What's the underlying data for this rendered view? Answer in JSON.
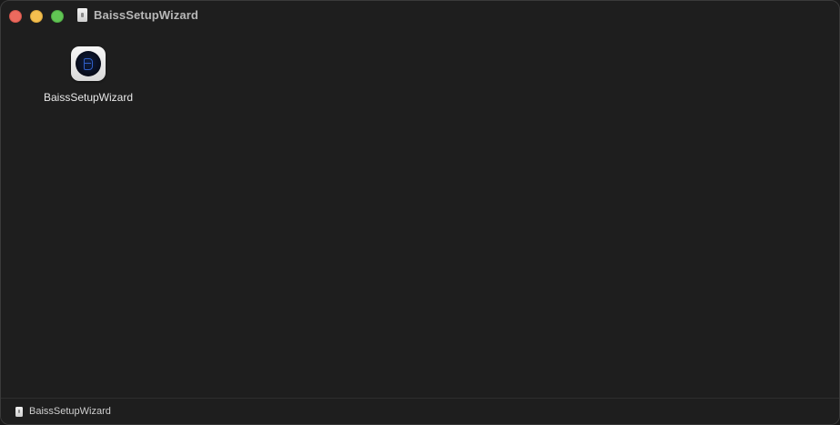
{
  "window": {
    "title": "BaissSetupWizard"
  },
  "content": {
    "items": [
      {
        "label": "BaissSetupWizard",
        "icon": "app-icon"
      }
    ]
  },
  "statusbar": {
    "path": "BaissSetupWizard"
  },
  "colors": {
    "window_bg": "#1e1e1e",
    "close": "#ec6a5e",
    "minimize": "#f4bf4f",
    "zoom": "#61c554"
  }
}
